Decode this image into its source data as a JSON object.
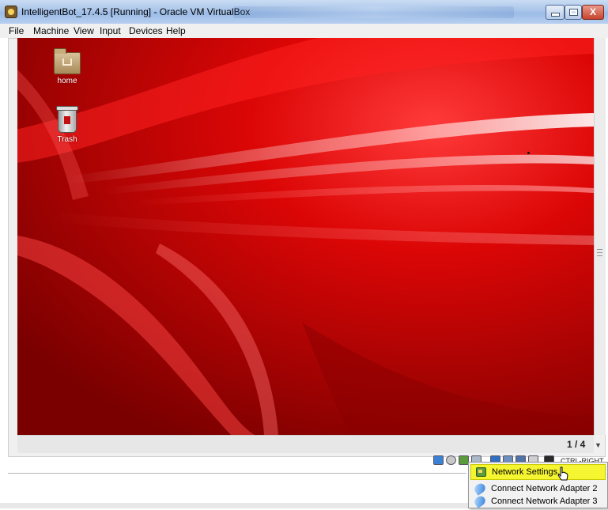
{
  "window": {
    "title": "IntelligentBot_17.4.5 [Running] - Oracle VM VirtualBox",
    "minimize_glyph": "",
    "close_glyph": "X"
  },
  "menubar": {
    "items": [
      "File",
      "Machine",
      "View",
      "Input",
      "Devices",
      "Help"
    ]
  },
  "desktop": {
    "icons": [
      {
        "label": "home",
        "icon": "home-folder-icon"
      },
      {
        "label": "Trash",
        "icon": "trash-icon"
      }
    ]
  },
  "viewport": {
    "page_indicator": "1 / 4"
  },
  "statusbar": {
    "host_key_label": "CTRL-RIGHT",
    "icons": [
      "optical-drive-icon",
      "usb-icon",
      "network-icon",
      "shared-folder-icon",
      "display-icon",
      "video-capture-icon",
      "mouse-integration-icon",
      "host-key-icon"
    ]
  },
  "context_menu": {
    "items": [
      {
        "label": "Network Settings...",
        "icon": "network-settings-icon",
        "highlighted": true
      },
      {
        "label": "Connect Network Adapter 2",
        "icon": "connect-adapter-icon"
      },
      {
        "label": "Connect Network Adapter 3",
        "icon": "connect-adapter-icon"
      }
    ]
  },
  "colors": {
    "wallpaper_red": "#c20000",
    "highlight_yellow": "#f5f532",
    "titlebar_blue": "#a9c5ea"
  }
}
